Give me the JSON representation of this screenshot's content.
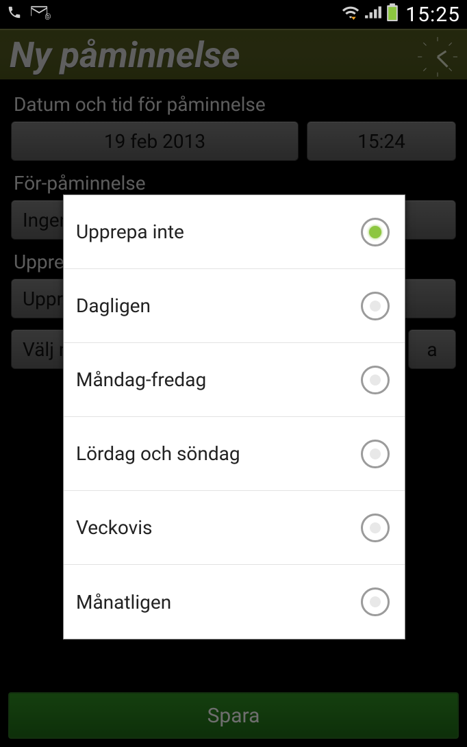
{
  "status": {
    "time": "15:25"
  },
  "titlebar": {
    "title": "Ny påminnelse"
  },
  "form": {
    "section_datetime_label": "Datum och tid för påminnelse",
    "date_value": "19 feb 2013",
    "time_value": "15:24",
    "prealarm_label": "För-påminnelse",
    "prealarm_value": "Ingen",
    "repeat_label": "Upprepa",
    "repeat_value": "Upprepa inte",
    "memo_value": "Välj memo",
    "extra_suffix": "a",
    "save_label": "Spara"
  },
  "dialog": {
    "options": [
      {
        "label": "Upprepa inte",
        "selected": true
      },
      {
        "label": "Dagligen",
        "selected": false
      },
      {
        "label": "Måndag-fredag",
        "selected": false
      },
      {
        "label": "Lördag och söndag",
        "selected": false
      },
      {
        "label": "Veckovis",
        "selected": false
      },
      {
        "label": "Månatligen",
        "selected": false
      }
    ]
  }
}
